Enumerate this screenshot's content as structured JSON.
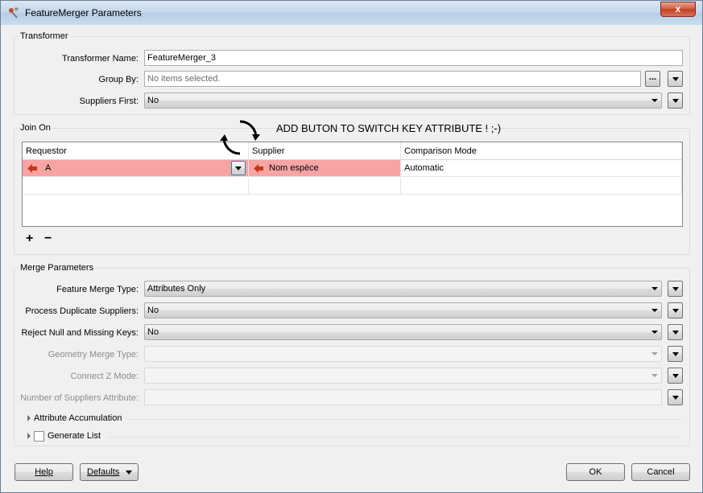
{
  "window": {
    "title": "FeatureMerger Parameters",
    "close_label": "x"
  },
  "transformer": {
    "group_label": "Transformer",
    "name_label": "Transformer Name:",
    "name_value": "FeatureMerger_3",
    "group_by_label": "Group By:",
    "group_by_placeholder": "No items selected.",
    "group_by_browse": "...",
    "suppliers_first_label": "Suppliers First:",
    "suppliers_first_value": "No"
  },
  "join_on": {
    "group_label": "Join On",
    "annotation": "ADD BUTON TO SWITCH KEY ATTRIBUTE ! ;-)",
    "columns": [
      "Requestor",
      "Supplier",
      "Comparison Mode"
    ],
    "rows": [
      {
        "requestor": "A",
        "supplier": "Nom espèce",
        "mode": "Automatic"
      }
    ],
    "add_label": "+",
    "remove_label": "−"
  },
  "merge": {
    "group_label": "Merge Parameters",
    "feature_merge_type_label": "Feature Merge Type:",
    "feature_merge_type_value": "Attributes Only",
    "process_duplicate_label": "Process Duplicate Suppliers:",
    "process_duplicate_value": "No",
    "reject_null_label": "Reject Null and Missing Keys:",
    "reject_null_value": "No",
    "geometry_merge_label": "Geometry Merge Type:",
    "connect_z_label": "Connect Z Mode:",
    "num_suppliers_label": "Number of Suppliers Attribute:",
    "attribute_accumulation_label": "Attribute Accumulation",
    "generate_list_label": "Generate List"
  },
  "footer": {
    "help_label": "Help",
    "defaults_label": "Defaults",
    "ok_label": "OK",
    "cancel_label": "Cancel"
  }
}
